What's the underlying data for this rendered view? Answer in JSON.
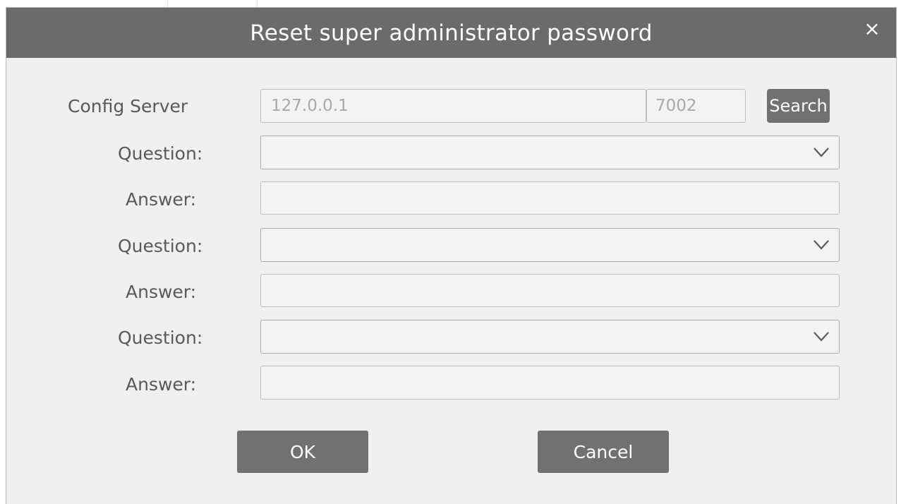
{
  "dialog": {
    "title": "Reset super administrator password",
    "close_icon": "×"
  },
  "config_server": {
    "label": "Config Server",
    "ip": "127.0.0.1",
    "port": "7002",
    "search_label": "Search"
  },
  "security": {
    "question_label": "Question:",
    "answer_label": "Answer:",
    "q1_value": "",
    "a1_value": "",
    "q2_value": "",
    "a2_value": "",
    "q3_value": "",
    "a3_value": ""
  },
  "buttons": {
    "ok_label": "OK",
    "cancel_label": "Cancel"
  }
}
